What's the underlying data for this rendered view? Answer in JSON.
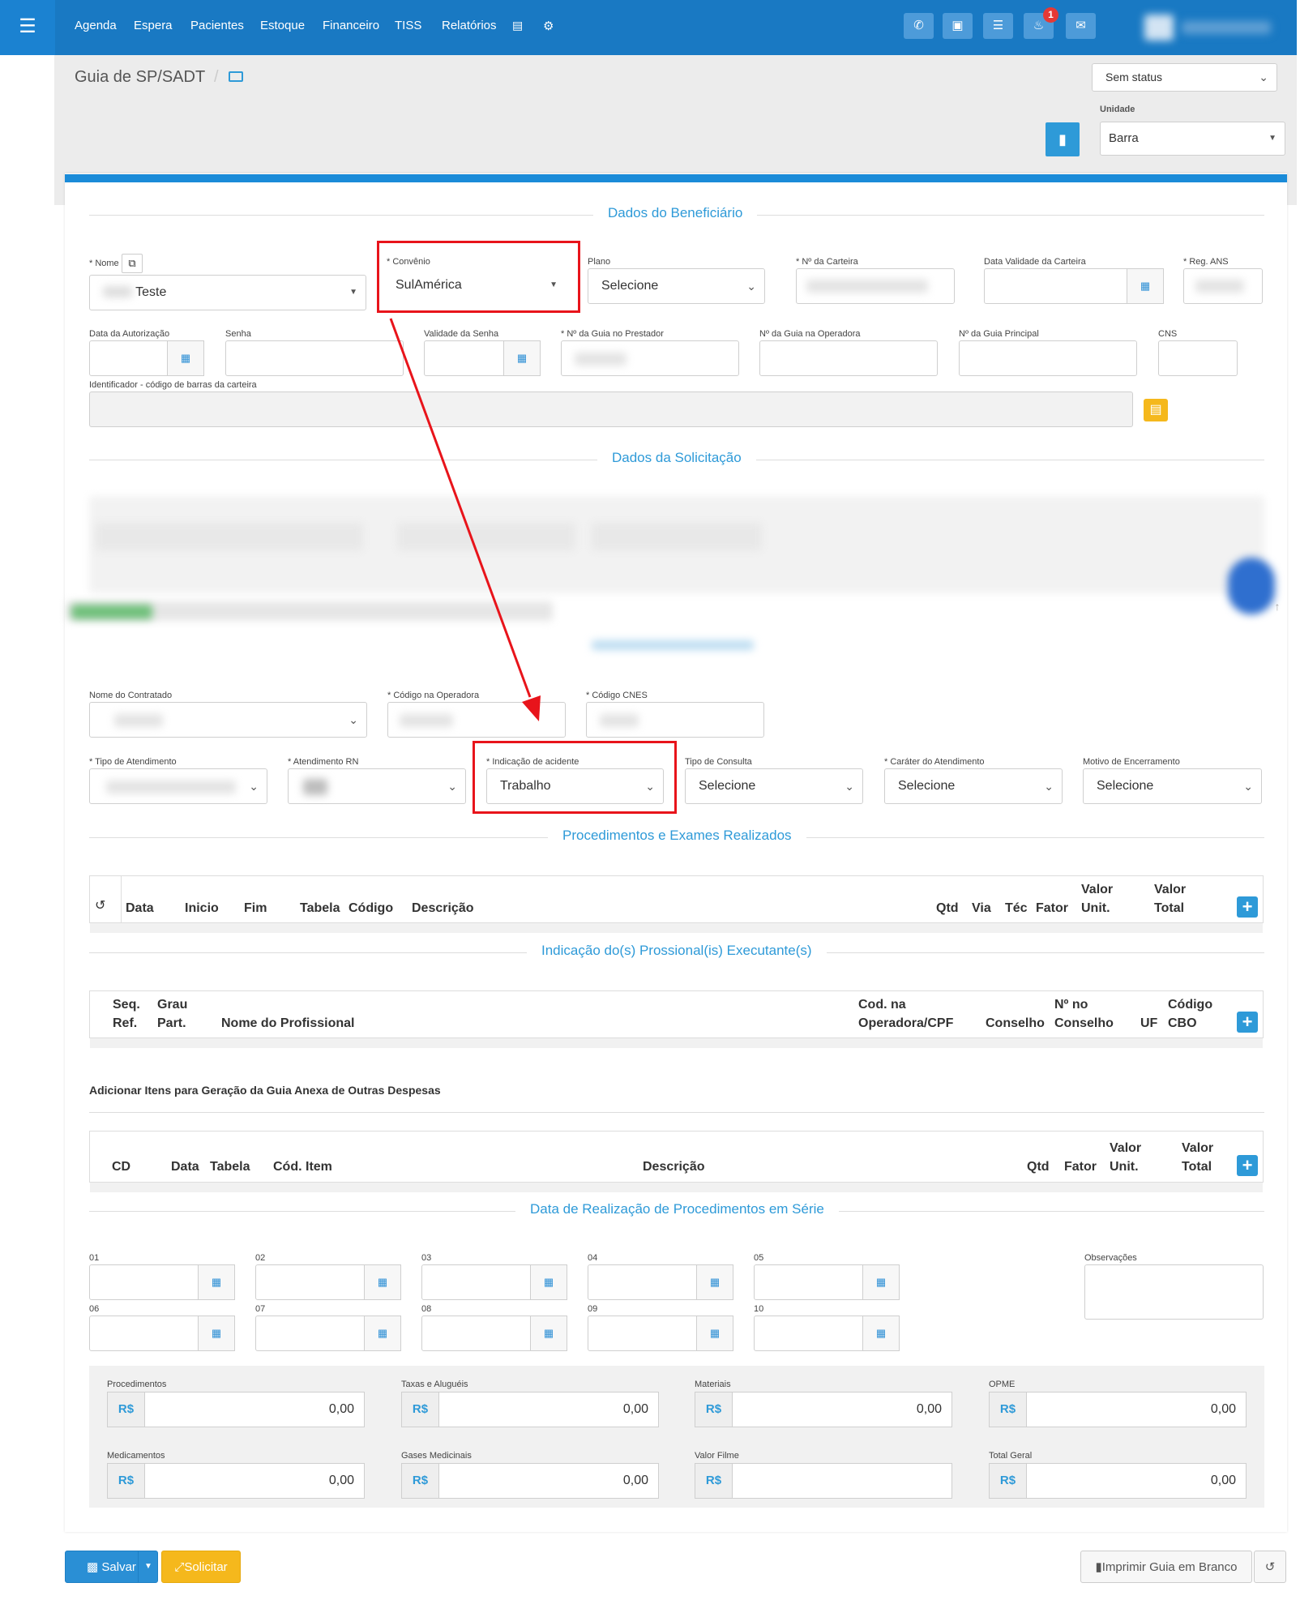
{
  "nav": {
    "items": [
      "Agenda",
      "Espera",
      "Pacientes",
      "Estoque",
      "Financeiro",
      "TISS",
      "Relatórios"
    ],
    "notif_count": "1"
  },
  "header": {
    "title": "Guia de SP/SADT",
    "status": "Sem status",
    "unit_label": "Unidade",
    "unit_value": "Barra"
  },
  "benef": {
    "section": "Dados do Beneficiário",
    "nome_label": "* Nome",
    "nome_value": "Teste",
    "convenio_label": "* Convênio",
    "convenio_value": "SulAmérica",
    "plano_label": "Plano",
    "plano_value": "Selecione",
    "carteira_label": "* Nº da Carteira",
    "validade_carteira_label": "Data Validade da Carteira",
    "reg_ans_label": "* Reg. ANS",
    "data_autorizacao_label": "Data da Autorização",
    "senha_label": "Senha",
    "validade_senha_label": "Validade da Senha",
    "guia_prestador_label": "* Nº da Guia no Prestador",
    "guia_operadora_label": "Nº da Guia na Operadora",
    "guia_principal_label": "Nº da Guia Principal",
    "cns_label": "CNS",
    "identificador_label": "Identificador - código de barras da carteira"
  },
  "solicitacao": {
    "section": "Dados da Solicitação"
  },
  "execucao": {
    "nome_contratado_label": "Nome do Contratado",
    "codigo_operadora_label": "* Código na Operadora",
    "codigo_cnes_label": "* Código CNES",
    "tipo_atendimento_label": "* Tipo de Atendimento",
    "atendimento_rn_label": "* Atendimento RN",
    "indicacao_acidente_label": "* Indicação de acidente",
    "indicacao_acidente_value": "Trabalho",
    "tipo_consulta_label": "Tipo de Consulta",
    "tipo_consulta_value": "Selecione",
    "carater_label": "* Caráter do Atendimento",
    "carater_value": "Selecione",
    "motivo_label": "Motivo de Encerramento",
    "motivo_value": "Selecione"
  },
  "procedimentos": {
    "section": "Procedimentos e Exames Realizados",
    "cols": [
      "Data",
      "Inicio",
      "Fim",
      "Tabela",
      "Código",
      "Descrição",
      "Qtd",
      "Via",
      "Téc",
      "Fator",
      "Valor",
      "Unit.",
      "Valor",
      "Total"
    ]
  },
  "profissionais": {
    "section": "Indicação do(s) Prossional(is) Executante(s)",
    "cols": [
      "Seq.",
      "Ref.",
      "Grau",
      "Part.",
      "Nome do Profissional",
      "Cod. na",
      "Operadora/CPF",
      "Conselho",
      "Nº no",
      "Conselho",
      "UF",
      "Código",
      "CBO"
    ]
  },
  "despesas": {
    "title": "Adicionar Itens para Geração da Guia Anexa de Outras Despesas",
    "cols": [
      "CD",
      "Data",
      "Tabela",
      "Cód. Item",
      "Descrição",
      "Qtd",
      "Fator",
      "Valor",
      "Unit.",
      "Valor",
      "Total"
    ]
  },
  "serie": {
    "section": "Data de Realização de Procedimentos em Série",
    "labels": [
      "01",
      "02",
      "03",
      "04",
      "05",
      "06",
      "07",
      "08",
      "09",
      "10"
    ],
    "obs_label": "Observações"
  },
  "totais": {
    "currency": "R$",
    "items": [
      {
        "label": "Procedimentos",
        "value": "0,00"
      },
      {
        "label": "Taxas e Aluguéis",
        "value": "0,00"
      },
      {
        "label": "Materiais",
        "value": "0,00"
      },
      {
        "label": "OPME",
        "value": "0,00"
      },
      {
        "label": "Medicamentos",
        "value": "0,00"
      },
      {
        "label": "Gases Medicinais",
        "value": "0,00"
      },
      {
        "label": "Valor Filme",
        "value": ""
      },
      {
        "label": "Total Geral",
        "value": "0,00"
      }
    ]
  },
  "footer": {
    "salvar": "Salvar",
    "solicitar": "Solicitar",
    "imprimir": "Imprimir Guia em Branco"
  }
}
